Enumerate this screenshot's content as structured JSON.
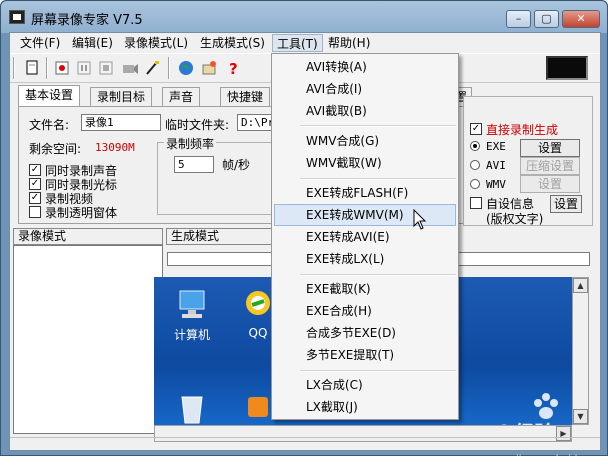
{
  "window": {
    "title": "屏幕录像专家 V7.5",
    "min": "–",
    "max": "▢",
    "close": "✕"
  },
  "menubar": [
    {
      "label": "文件(F)"
    },
    {
      "label": "编辑(E)"
    },
    {
      "label": "录像模式(L)"
    },
    {
      "label": "生成模式(S)"
    },
    {
      "label": "工具(T)"
    },
    {
      "label": "帮助(H)"
    }
  ],
  "toolbar": {
    "icons": [
      "new-file-icon",
      "record-icon",
      "pause-icon",
      "stop-icon",
      "camera-icon",
      "brush-icon",
      "globe-icon",
      "paint-icon",
      "help-icon"
    ]
  },
  "tabs": [
    "基本设置",
    "录制目标",
    "声音",
    "快捷键",
    "置"
  ],
  "basic": {
    "filename_label": "文件名:",
    "filename_value": "录像1",
    "tempfolder_label": "临时文件夹:",
    "tempfolder_value": "D:\\Pr",
    "space_label": "剩余空间:",
    "space_value": "13090M",
    "checks": [
      {
        "label": "同时录制声音",
        "checked": true
      },
      {
        "label": "同时录制光标",
        "checked": true
      },
      {
        "label": "录制视频",
        "checked": true
      },
      {
        "label": "录制透明窗体",
        "checked": false
      }
    ],
    "fps_group": "录制频率",
    "fps_value": "5",
    "fps_unit": "帧/秒"
  },
  "right_panel": {
    "direct_label": "直接录制生成",
    "direct_checked": true,
    "direct_color": "#cc0000",
    "options": [
      {
        "label": "EXE",
        "selected": true,
        "button": "设置",
        "enabled": true
      },
      {
        "label": "AVI",
        "selected": false,
        "button": "压缩设置",
        "enabled": false
      },
      {
        "label": "WMV",
        "selected": false,
        "button": "设置",
        "enabled": false
      }
    ],
    "custom_label": "自设信息",
    "custom_sub": "(版权文字)",
    "custom_checked": false,
    "custom_button": "设置"
  },
  "headers": {
    "left": "录像模式",
    "right": "生成模式"
  },
  "desktop": {
    "icons": [
      {
        "name": "computer-icon",
        "label": "计算机"
      },
      {
        "name": "qq-icon",
        "label": "QQ"
      }
    ],
    "watermark": "Bai 经验",
    "watermark_url": "jingyan.baidu.com"
  },
  "dropdown": {
    "groups": [
      [
        "AVI转换(A)",
        "AVI合成(I)",
        "AVI截取(B)"
      ],
      [
        "WMV合成(G)",
        "WMV截取(W)"
      ],
      [
        "EXE转成FLASH(F)",
        "EXE转成WMV(M)",
        "EXE转成AVI(E)",
        "EXE转成LX(L)"
      ],
      [
        "EXE截取(K)",
        "EXE合成(H)",
        "合成多节EXE(D)",
        "多节EXE提取(T)"
      ],
      [
        "LX合成(C)",
        "LX截取(J)"
      ]
    ],
    "hovered": "EXE转成WMV(M)"
  },
  "colors": {
    "accent": "#cc0000",
    "titlebar": "#9bb8d6",
    "hover": "#dce8f6"
  }
}
